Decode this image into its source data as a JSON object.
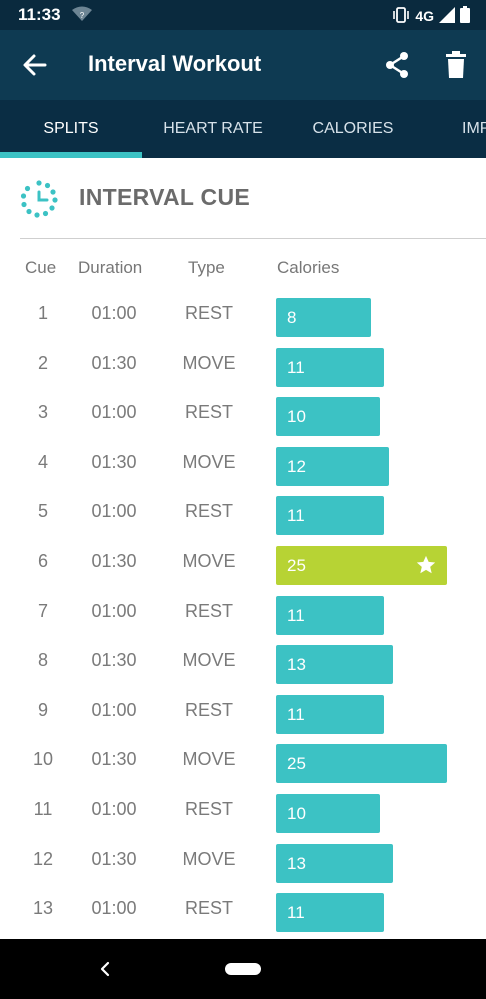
{
  "status_bar": {
    "time": "11:33",
    "network": "4G",
    "icons": [
      "wifi-question-icon",
      "vibrate-icon",
      "signal-icon",
      "battery-icon"
    ]
  },
  "app_bar": {
    "title": "Interval Workout",
    "icons": [
      "back-arrow-icon",
      "share-icon",
      "trash-icon"
    ]
  },
  "tabs": [
    {
      "label": "SPLITS",
      "active": true
    },
    {
      "label": "HEART RATE",
      "active": false
    },
    {
      "label": "CALORIES",
      "active": false
    },
    {
      "label": "IMP",
      "active": false
    }
  ],
  "section": {
    "title": "INTERVAL CUE",
    "icon": "interval-cue-icon"
  },
  "table": {
    "headers": [
      "Cue",
      "Duration",
      "Type",
      "Calories"
    ],
    "rows": [
      {
        "cue": "1",
        "duration": "01:00",
        "type": "REST",
        "calories": 8
      },
      {
        "cue": "2",
        "duration": "01:30",
        "type": "MOVE",
        "calories": 11
      },
      {
        "cue": "3",
        "duration": "01:00",
        "type": "REST",
        "calories": 10
      },
      {
        "cue": "4",
        "duration": "01:30",
        "type": "MOVE",
        "calories": 12
      },
      {
        "cue": "5",
        "duration": "01:00",
        "type": "REST",
        "calories": 11
      },
      {
        "cue": "6",
        "duration": "01:30",
        "type": "MOVE",
        "calories": 25,
        "best": true
      },
      {
        "cue": "7",
        "duration": "01:00",
        "type": "REST",
        "calories": 11
      },
      {
        "cue": "8",
        "duration": "01:30",
        "type": "MOVE",
        "calories": 13
      },
      {
        "cue": "9",
        "duration": "01:00",
        "type": "REST",
        "calories": 11
      },
      {
        "cue": "10",
        "duration": "01:30",
        "type": "MOVE",
        "calories": 25
      },
      {
        "cue": "11",
        "duration": "01:00",
        "type": "REST",
        "calories": 10
      },
      {
        "cue": "12",
        "duration": "01:30",
        "type": "MOVE",
        "calories": 13
      },
      {
        "cue": "13",
        "duration": "01:00",
        "type": "REST",
        "calories": 11
      }
    ]
  },
  "colors": {
    "bar": "#3cc2c4",
    "best_bar": "#b7d334",
    "header_bg": "#0e3a52",
    "tab_indicator": "#3cc2c4"
  },
  "nav_bar": {
    "icons": [
      "nav-back-icon",
      "home-pill-icon"
    ]
  }
}
